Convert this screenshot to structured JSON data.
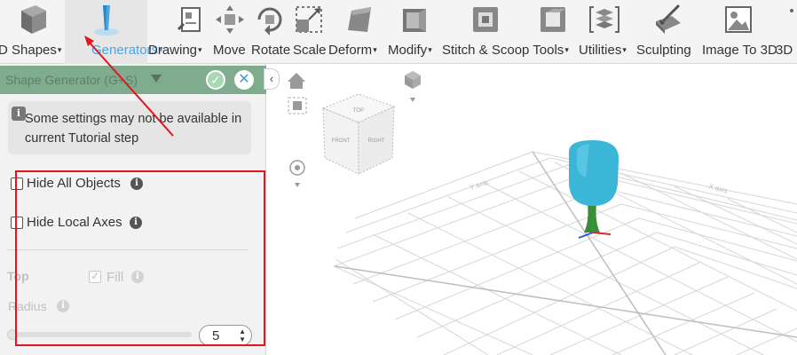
{
  "toolbar": {
    "items": [
      {
        "label": "D Shapes",
        "caret": "▾",
        "icon": "cube-icon"
      },
      {
        "label": "Generators",
        "caret": "▾",
        "icon": "generator-icon"
      },
      {
        "label": "Drawing",
        "caret": "▾",
        "icon": "drawing-icon"
      },
      {
        "label": "Move",
        "icon": "move-icon"
      },
      {
        "label": "Rotate",
        "icon": "rotate-icon"
      },
      {
        "label": "Scale",
        "icon": "scale-icon"
      },
      {
        "label": "Deform",
        "caret": "▾",
        "icon": "deform-icon"
      },
      {
        "label": "Modify",
        "caret": "▾",
        "icon": "modify-icon"
      },
      {
        "label": "Stitch & Scoop Tools",
        "caret": "▾",
        "icon": "stitch-scoop-icon"
      },
      {
        "label": "Utilities",
        "caret": "▾",
        "icon": "utilities-icon"
      },
      {
        "label": "Sculpting",
        "icon": "sculpting-icon"
      },
      {
        "label": "Image To 3D",
        "icon": "image-to-3d-icon"
      },
      {
        "label": "3D",
        "icon": "more-icon"
      }
    ],
    "active_index": 1,
    "accent_color": "#4aa6e0"
  },
  "panel": {
    "title": "Shape Generator (G+S)",
    "header_color": "#7fab8f",
    "collapse_glyph": "‹",
    "ok_glyph": "✓",
    "close_glyph": "✕",
    "notice": {
      "icon": "i",
      "text": "Some settings may not be available in current Tutorial step"
    },
    "hide_all_objects": {
      "label": "Hide All Objects",
      "checked": false,
      "help": "i"
    },
    "hide_local_axes": {
      "label": "Hide Local Axes",
      "checked": false,
      "help": "i"
    },
    "top": {
      "label": "Top",
      "fill_label": "Fill",
      "fill_checked": true,
      "check_glyph": "✓",
      "help": "i"
    },
    "radius": {
      "label": "Radius",
      "value": "5",
      "help": "i",
      "up": "▲",
      "down": "▼"
    }
  },
  "viewport": {
    "view_cube_faces": {
      "top": "TOP",
      "front": "FRONT",
      "right": "RIGHT"
    },
    "axis_labels": {
      "left": "Y axis",
      "right": "X axis"
    },
    "shape_color": "#3cb6d6"
  },
  "annotation": {
    "box_color": "#e0161e"
  }
}
